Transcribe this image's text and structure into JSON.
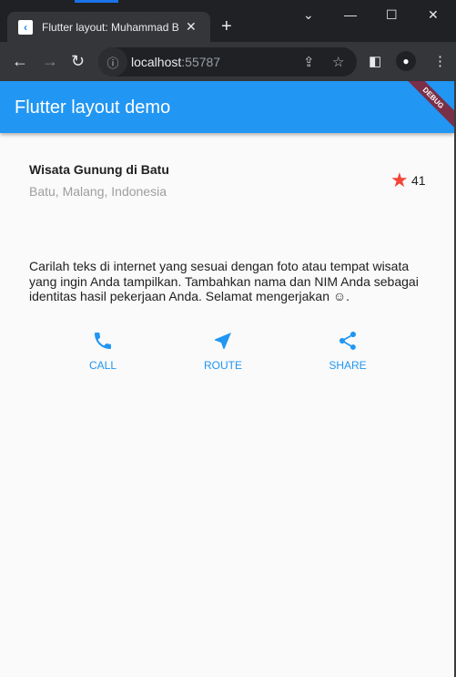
{
  "browser": {
    "tab_title": "Flutter layout: Muhammad Bi",
    "url_host": "localhost",
    "url_port": ":55787"
  },
  "app": {
    "title": "Flutter layout demo",
    "debug_banner": "DEBUG"
  },
  "place": {
    "name": "Wisata Gunung di Batu",
    "location": "Batu, Malang, Indonesia",
    "rating_count": "41"
  },
  "description": "Carilah teks di internet yang sesuai dengan foto atau tempat wisata yang ingin Anda tampilkan. Tambahkan nama dan NIM Anda sebagai identitas hasil pekerjaan Anda. Selamat mengerjakan ☺.",
  "actions": [
    {
      "label": "CALL"
    },
    {
      "label": "ROUTE"
    },
    {
      "label": "SHARE"
    }
  ],
  "colors": {
    "primary": "#2196f3",
    "star": "#f44336"
  }
}
